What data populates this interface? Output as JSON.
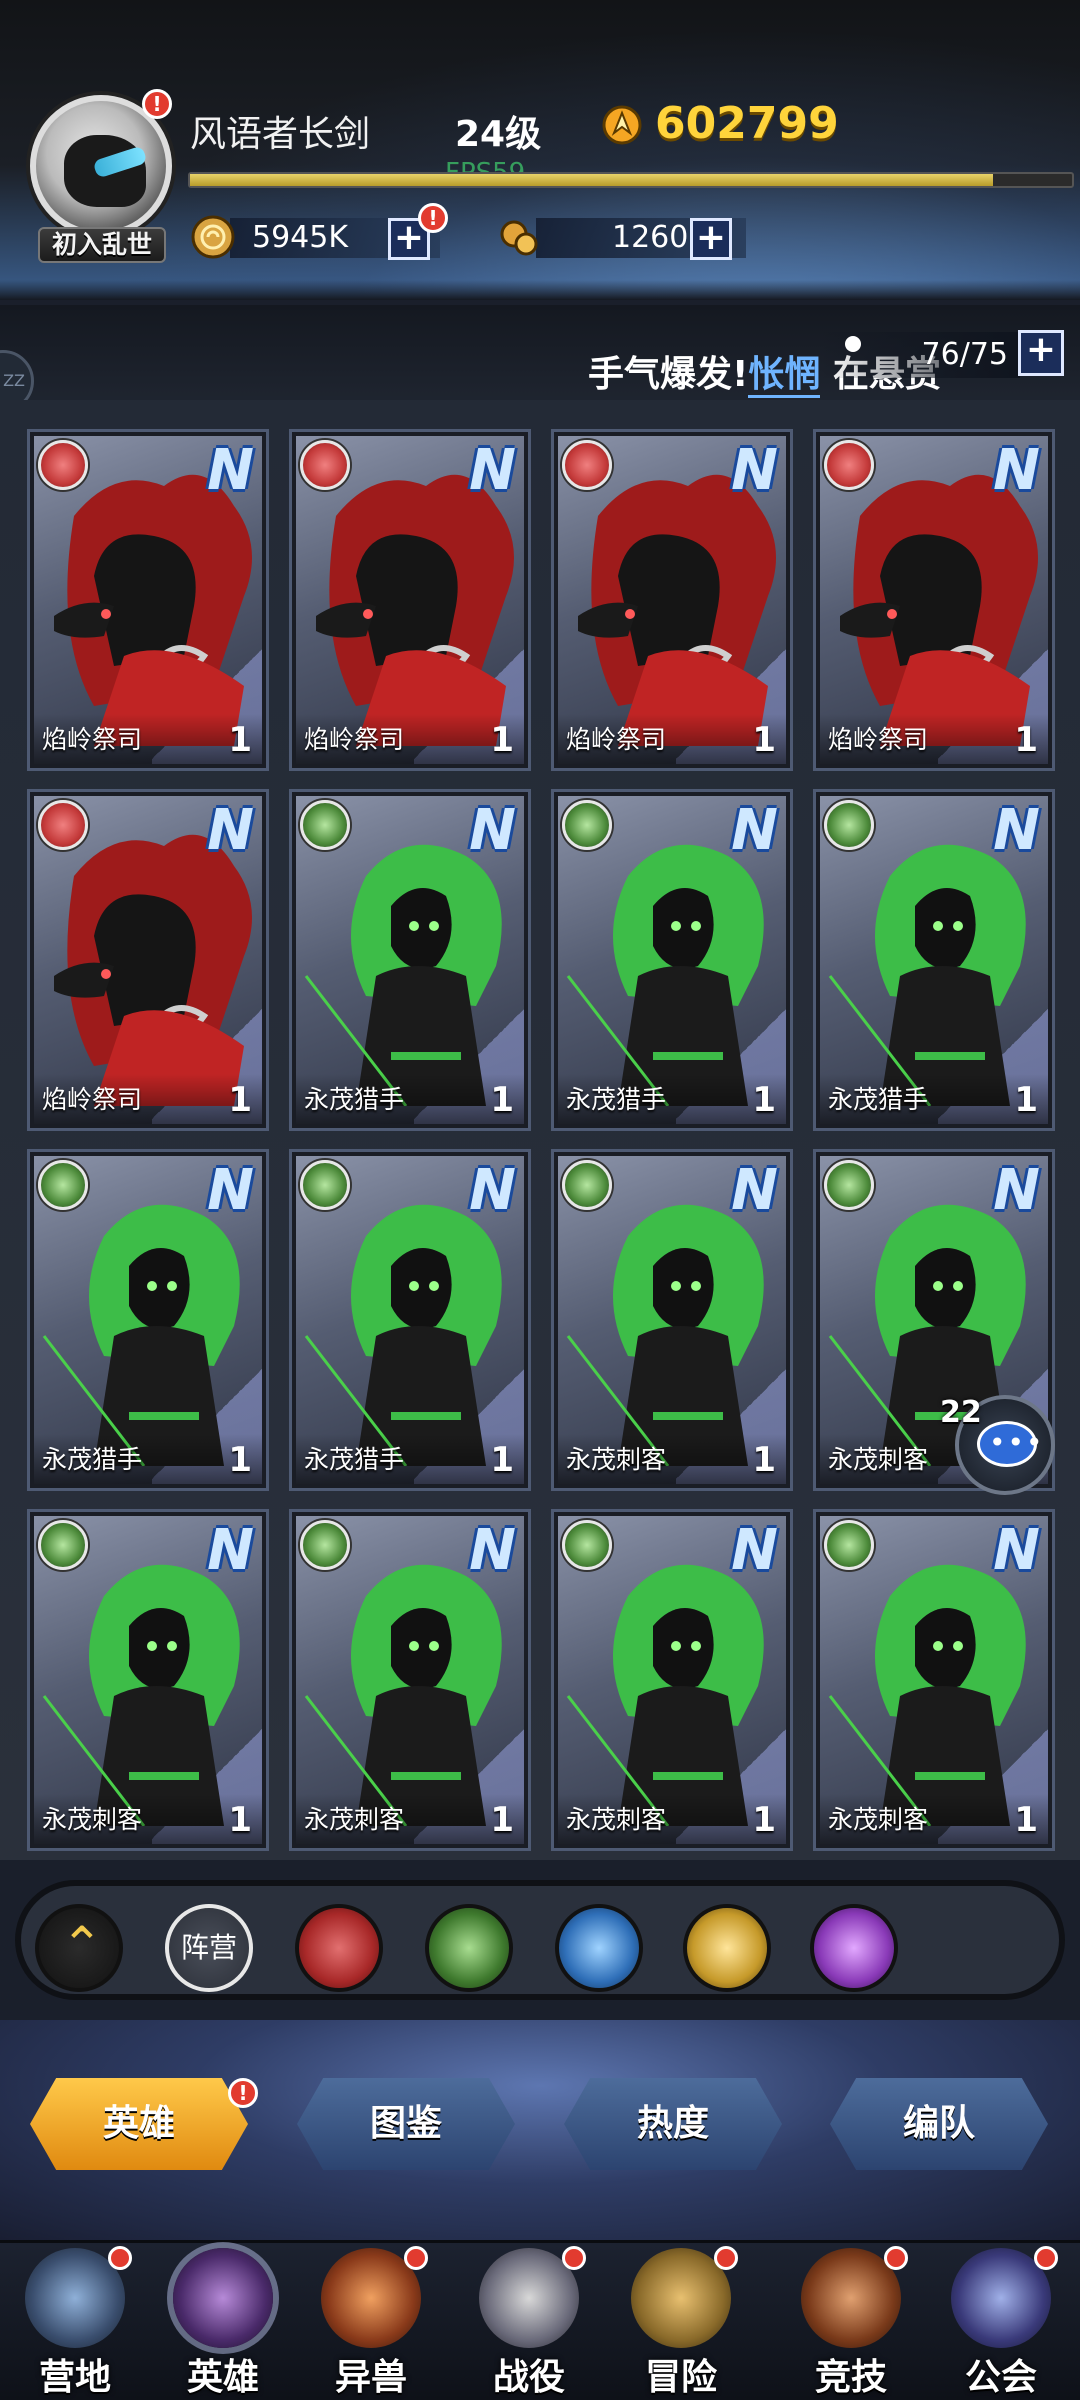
{
  "player": {
    "name": "风语者长剑",
    "level": "24级",
    "gold": "602799",
    "title_badge": "初入乱世",
    "fps": "FPS59",
    "exp_fraction": 0.91
  },
  "resources": {
    "coins": "5945K",
    "crystals": "1260"
  },
  "subbar": {
    "marquee_prefix": "手气爆发!",
    "marquee_highlight": "怅惘",
    "marquee_suffix": " 在悬赏",
    "capacity": "76/75",
    "zz_label": "ZZ"
  },
  "heroes": [
    {
      "name": "焰岭祭司",
      "level": "1",
      "faction": "fire",
      "rank": "N"
    },
    {
      "name": "焰岭祭司",
      "level": "1",
      "faction": "fire",
      "rank": "N"
    },
    {
      "name": "焰岭祭司",
      "level": "1",
      "faction": "fire",
      "rank": "N"
    },
    {
      "name": "焰岭祭司",
      "level": "1",
      "faction": "fire",
      "rank": "N"
    },
    {
      "name": "焰岭祭司",
      "level": "1",
      "faction": "fire",
      "rank": "N"
    },
    {
      "name": "永茂猎手",
      "level": "1",
      "faction": "nature",
      "rank": "N"
    },
    {
      "name": "永茂猎手",
      "level": "1",
      "faction": "nature",
      "rank": "N"
    },
    {
      "name": "永茂猎手",
      "level": "1",
      "faction": "nature",
      "rank": "N"
    },
    {
      "name": "永茂猎手",
      "level": "1",
      "faction": "nature",
      "rank": "N"
    },
    {
      "name": "永茂猎手",
      "level": "1",
      "faction": "nature",
      "rank": "N"
    },
    {
      "name": "永茂刺客",
      "level": "1",
      "faction": "nature",
      "rank": "N"
    },
    {
      "name": "永茂刺客",
      "level": "1",
      "faction": "nature",
      "rank": "N"
    },
    {
      "name": "永茂刺客",
      "level": "1",
      "faction": "nature",
      "rank": "N"
    },
    {
      "name": "永茂刺客",
      "level": "1",
      "faction": "nature",
      "rank": "N"
    },
    {
      "name": "永茂刺客",
      "level": "1",
      "faction": "nature",
      "rank": "N"
    },
    {
      "name": "永茂刺客",
      "level": "1",
      "faction": "nature",
      "rank": "N"
    }
  ],
  "chat": {
    "unread": "22"
  },
  "filters": {
    "camp_label": "阵营",
    "icons": [
      "sort-up-icon",
      "fire-faction-icon",
      "nature-faction-icon",
      "water-faction-icon",
      "light-faction-icon",
      "dark-faction-icon"
    ]
  },
  "tabs": [
    {
      "label": "英雄",
      "active": true,
      "alert": true
    },
    {
      "label": "图鉴",
      "active": false
    },
    {
      "label": "热度",
      "active": false
    },
    {
      "label": "编队",
      "active": false
    }
  ],
  "nav": [
    {
      "label": "营地",
      "dot": true
    },
    {
      "label": "英雄",
      "dot": false,
      "active": true
    },
    {
      "label": "异兽",
      "dot": true
    },
    {
      "label": "战役",
      "dot": true
    },
    {
      "label": "冒险",
      "dot": true
    },
    {
      "label": "竞技",
      "dot": true
    },
    {
      "label": "公会",
      "dot": true
    }
  ],
  "colors": {
    "gold": "#ffd43b",
    "alert": "#e23b2f",
    "tab_active": "#f0a020",
    "tab_inactive": "#3c5a88",
    "fps": "#3ec56a"
  }
}
